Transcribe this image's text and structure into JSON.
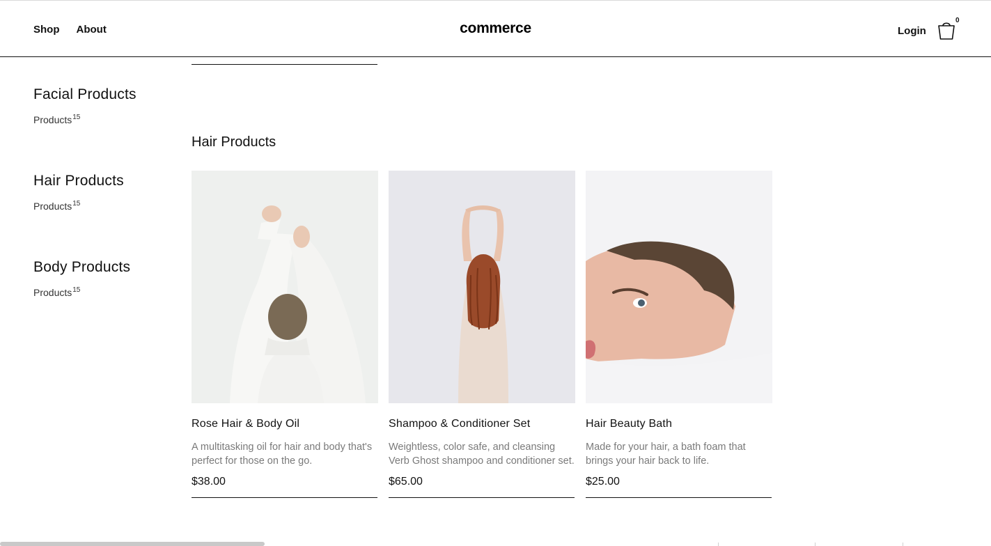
{
  "nav": {
    "shop": "Shop",
    "about": "About"
  },
  "brand": "commerce",
  "header": {
    "login": "Login",
    "cart_count": "0",
    "cart_icon": "shopping-bag-icon"
  },
  "sidebar": {
    "categories": [
      {
        "title": "Facial Products",
        "sub": "Products",
        "count": "15"
      },
      {
        "title": "Hair Products",
        "sub": "Products",
        "count": "15"
      },
      {
        "title": "Body Products",
        "sub": "Products",
        "count": "15"
      }
    ]
  },
  "section": {
    "title": "Hair Products"
  },
  "products": [
    {
      "name": "Rose Hair & Body Oil",
      "description": "A multitasking oil for hair and body that's perfect for those on the go.",
      "price": "$38.00",
      "image": "person-arms-raised-photo"
    },
    {
      "name": "Shampoo & Conditioner Set",
      "description": "Weightless, color safe, and cleansing Verb Ghost shampoo and conditioner set.",
      "price": "$65.00",
      "image": "woman-red-hair-back-photo"
    },
    {
      "name": "Hair Beauty Bath",
      "description": "Made for your hair, a bath foam that brings your hair back to life.",
      "price": "$25.00",
      "image": "woman-face-in-milk-bath-photo"
    }
  ],
  "colors": {
    "text": "#111111",
    "muted": "#7a7a7a",
    "rule": "#111111",
    "background": "#ffffff"
  }
}
